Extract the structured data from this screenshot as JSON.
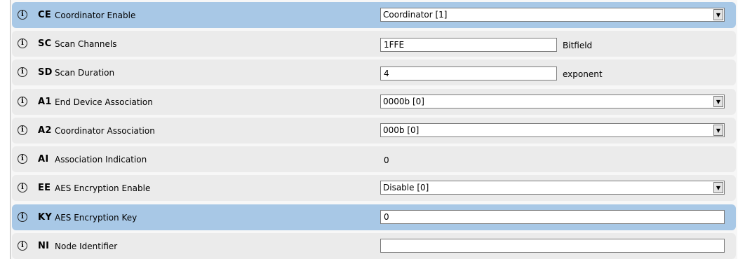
{
  "rows": [
    {
      "code": "CE",
      "label": "Coordinator Enable",
      "control": "select",
      "value": "Coordinator [1]",
      "selected": true
    },
    {
      "code": "SC",
      "label": "Scan Channels",
      "control": "text",
      "value": "1FFE",
      "suffix": "Bitfield"
    },
    {
      "code": "SD",
      "label": "Scan Duration",
      "control": "text",
      "value": "4",
      "suffix": "exponent"
    },
    {
      "code": "A1",
      "label": "End Device Association",
      "control": "select",
      "value": "0000b [0]"
    },
    {
      "code": "A2",
      "label": "Coordinator Association",
      "control": "select",
      "value": "000b [0]"
    },
    {
      "code": "AI",
      "label": "Association Indication",
      "control": "static",
      "value": "0"
    },
    {
      "code": "EE",
      "label": "AES Encryption Enable",
      "control": "select",
      "value": "Disable [0]"
    },
    {
      "code": "KY",
      "label": "AES Encryption Key",
      "control": "text-long",
      "value": "0",
      "selected": true
    },
    {
      "code": "NI",
      "label": "Node Identifier",
      "control": "text-long",
      "value": ""
    }
  ],
  "icons": {
    "info": "info-icon",
    "dropdown": "dropdown-arrow-icon"
  }
}
